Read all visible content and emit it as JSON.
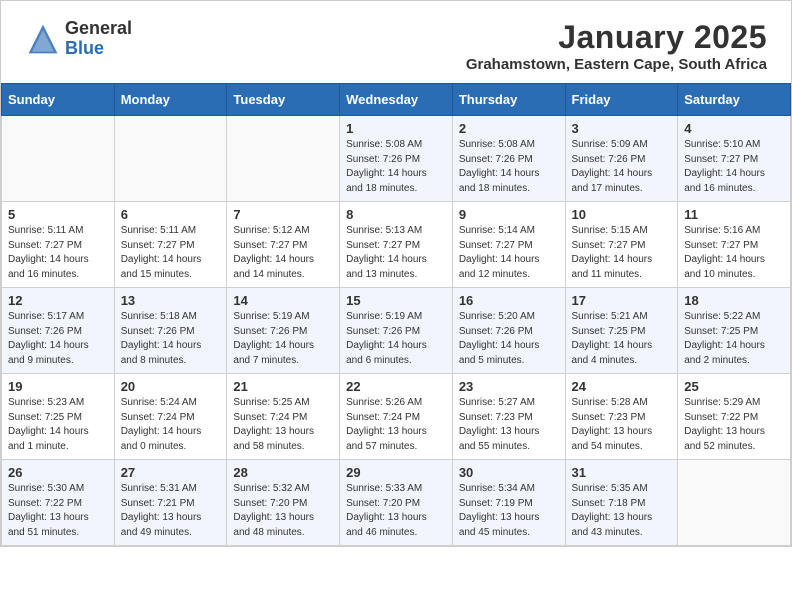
{
  "header": {
    "logo_general": "General",
    "logo_blue": "Blue",
    "month_year": "January 2025",
    "location": "Grahamstown, Eastern Cape, South Africa"
  },
  "days_of_week": [
    "Sunday",
    "Monday",
    "Tuesday",
    "Wednesday",
    "Thursday",
    "Friday",
    "Saturday"
  ],
  "weeks": [
    [
      {
        "day": "",
        "info": ""
      },
      {
        "day": "",
        "info": ""
      },
      {
        "day": "",
        "info": ""
      },
      {
        "day": "1",
        "info": "Sunrise: 5:08 AM\nSunset: 7:26 PM\nDaylight: 14 hours\nand 18 minutes."
      },
      {
        "day": "2",
        "info": "Sunrise: 5:08 AM\nSunset: 7:26 PM\nDaylight: 14 hours\nand 18 minutes."
      },
      {
        "day": "3",
        "info": "Sunrise: 5:09 AM\nSunset: 7:26 PM\nDaylight: 14 hours\nand 17 minutes."
      },
      {
        "day": "4",
        "info": "Sunrise: 5:10 AM\nSunset: 7:27 PM\nDaylight: 14 hours\nand 16 minutes."
      }
    ],
    [
      {
        "day": "5",
        "info": "Sunrise: 5:11 AM\nSunset: 7:27 PM\nDaylight: 14 hours\nand 16 minutes."
      },
      {
        "day": "6",
        "info": "Sunrise: 5:11 AM\nSunset: 7:27 PM\nDaylight: 14 hours\nand 15 minutes."
      },
      {
        "day": "7",
        "info": "Sunrise: 5:12 AM\nSunset: 7:27 PM\nDaylight: 14 hours\nand 14 minutes."
      },
      {
        "day": "8",
        "info": "Sunrise: 5:13 AM\nSunset: 7:27 PM\nDaylight: 14 hours\nand 13 minutes."
      },
      {
        "day": "9",
        "info": "Sunrise: 5:14 AM\nSunset: 7:27 PM\nDaylight: 14 hours\nand 12 minutes."
      },
      {
        "day": "10",
        "info": "Sunrise: 5:15 AM\nSunset: 7:27 PM\nDaylight: 14 hours\nand 11 minutes."
      },
      {
        "day": "11",
        "info": "Sunrise: 5:16 AM\nSunset: 7:27 PM\nDaylight: 14 hours\nand 10 minutes."
      }
    ],
    [
      {
        "day": "12",
        "info": "Sunrise: 5:17 AM\nSunset: 7:26 PM\nDaylight: 14 hours\nand 9 minutes."
      },
      {
        "day": "13",
        "info": "Sunrise: 5:18 AM\nSunset: 7:26 PM\nDaylight: 14 hours\nand 8 minutes."
      },
      {
        "day": "14",
        "info": "Sunrise: 5:19 AM\nSunset: 7:26 PM\nDaylight: 14 hours\nand 7 minutes."
      },
      {
        "day": "15",
        "info": "Sunrise: 5:19 AM\nSunset: 7:26 PM\nDaylight: 14 hours\nand 6 minutes."
      },
      {
        "day": "16",
        "info": "Sunrise: 5:20 AM\nSunset: 7:26 PM\nDaylight: 14 hours\nand 5 minutes."
      },
      {
        "day": "17",
        "info": "Sunrise: 5:21 AM\nSunset: 7:25 PM\nDaylight: 14 hours\nand 4 minutes."
      },
      {
        "day": "18",
        "info": "Sunrise: 5:22 AM\nSunset: 7:25 PM\nDaylight: 14 hours\nand 2 minutes."
      }
    ],
    [
      {
        "day": "19",
        "info": "Sunrise: 5:23 AM\nSunset: 7:25 PM\nDaylight: 14 hours\nand 1 minute."
      },
      {
        "day": "20",
        "info": "Sunrise: 5:24 AM\nSunset: 7:24 PM\nDaylight: 14 hours\nand 0 minutes."
      },
      {
        "day": "21",
        "info": "Sunrise: 5:25 AM\nSunset: 7:24 PM\nDaylight: 13 hours\nand 58 minutes."
      },
      {
        "day": "22",
        "info": "Sunrise: 5:26 AM\nSunset: 7:24 PM\nDaylight: 13 hours\nand 57 minutes."
      },
      {
        "day": "23",
        "info": "Sunrise: 5:27 AM\nSunset: 7:23 PM\nDaylight: 13 hours\nand 55 minutes."
      },
      {
        "day": "24",
        "info": "Sunrise: 5:28 AM\nSunset: 7:23 PM\nDaylight: 13 hours\nand 54 minutes."
      },
      {
        "day": "25",
        "info": "Sunrise: 5:29 AM\nSunset: 7:22 PM\nDaylight: 13 hours\nand 52 minutes."
      }
    ],
    [
      {
        "day": "26",
        "info": "Sunrise: 5:30 AM\nSunset: 7:22 PM\nDaylight: 13 hours\nand 51 minutes."
      },
      {
        "day": "27",
        "info": "Sunrise: 5:31 AM\nSunset: 7:21 PM\nDaylight: 13 hours\nand 49 minutes."
      },
      {
        "day": "28",
        "info": "Sunrise: 5:32 AM\nSunset: 7:20 PM\nDaylight: 13 hours\nand 48 minutes."
      },
      {
        "day": "29",
        "info": "Sunrise: 5:33 AM\nSunset: 7:20 PM\nDaylight: 13 hours\nand 46 minutes."
      },
      {
        "day": "30",
        "info": "Sunrise: 5:34 AM\nSunset: 7:19 PM\nDaylight: 13 hours\nand 45 minutes."
      },
      {
        "day": "31",
        "info": "Sunrise: 5:35 AM\nSunset: 7:18 PM\nDaylight: 13 hours\nand 43 minutes."
      },
      {
        "day": "",
        "info": ""
      }
    ]
  ]
}
